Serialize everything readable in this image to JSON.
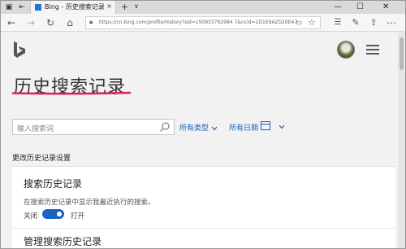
{
  "browser": {
    "tab_title": "Bing - 历史搜索记录",
    "tab_close": "×",
    "new_tab": "+",
    "tab_dropdown": "∨",
    "win_min": "—",
    "win_max": "☐",
    "win_close": "✕",
    "url": "https://cn.bing.com/profile/history?sid=150933792984 7&ncid=2D1E9A2D20EA7F7A74B23",
    "reading_view_icon": "reading-view-icon"
  },
  "page": {
    "title": "历史搜索记录",
    "search_placeholder": "输入搜索词",
    "filter_type": "所有类型",
    "filter_date": "所有日期",
    "section_label": "更改历史记录设置",
    "card": {
      "title": "搜索历史记录",
      "description": "在搜索历史记录中显示我最近执行的搜索。",
      "toggle_off_label": "关闭",
      "toggle_on_label": "打开",
      "toggle_state": "on",
      "next_title": "管理搜索历史记录"
    }
  },
  "colors": {
    "accent": "#1a60b8",
    "title_underline": "#d6226a",
    "toggle_on": "#1a62c6"
  }
}
